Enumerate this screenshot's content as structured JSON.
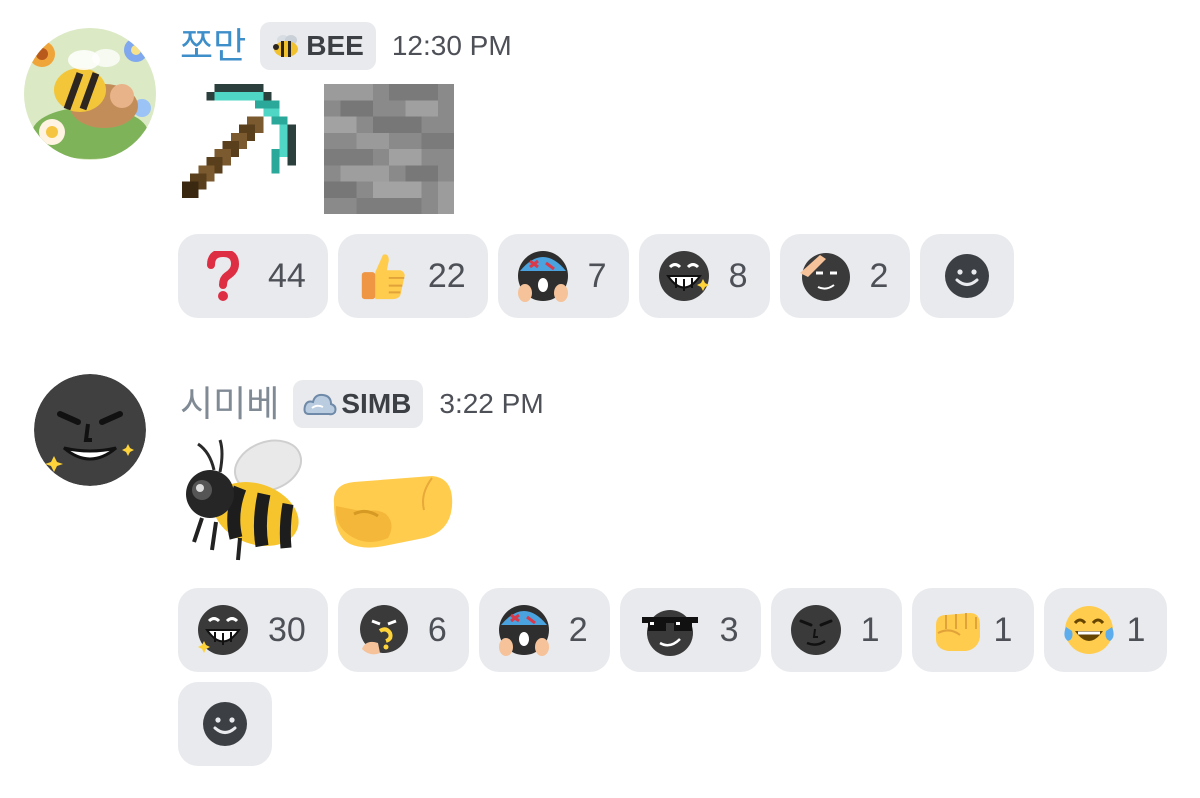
{
  "messages": [
    {
      "username": "쪼만",
      "username_color": "#3d8ec9",
      "tag": "BEE",
      "timestamp": "12:30 PM",
      "avatar_icon": "bee-flower-avatar",
      "attachments": [
        "diamond-pickaxe-icon",
        "stone-block-icon"
      ],
      "reactions": [
        {
          "emoji": "red-question-mark",
          "count": "44"
        },
        {
          "emoji": "thumbs-up",
          "count": "22"
        },
        {
          "emoji": "shocked-blob-face",
          "count": "7"
        },
        {
          "emoji": "grinning-blob-face",
          "count": "8"
        },
        {
          "emoji": "saluting-blob-face",
          "count": "2"
        }
      ]
    },
    {
      "username": "시미베",
      "username_color": "#808a94",
      "tag": "SIMB",
      "timestamp": "3:22 PM",
      "avatar_icon": "grinning-blob-avatar",
      "attachments": [
        "honeybee-emoji",
        "fist-emoji"
      ],
      "reactions": [
        {
          "emoji": "grinning-blob-face",
          "count": "30"
        },
        {
          "emoji": "thinking-blob-face",
          "count": "6"
        },
        {
          "emoji": "shocked-blob-face",
          "count": "2"
        },
        {
          "emoji": "sunglasses-blob-face",
          "count": "3"
        },
        {
          "emoji": "smirk-blob-face",
          "count": "1"
        },
        {
          "emoji": "oncoming-fist",
          "count": "1"
        },
        {
          "emoji": "tears-of-joy",
          "count": "1"
        }
      ]
    }
  ],
  "colors": {
    "reaction_bg": "#e9eaed",
    "count_text": "#4e5058",
    "add_reaction_icon": "#3c4045"
  }
}
